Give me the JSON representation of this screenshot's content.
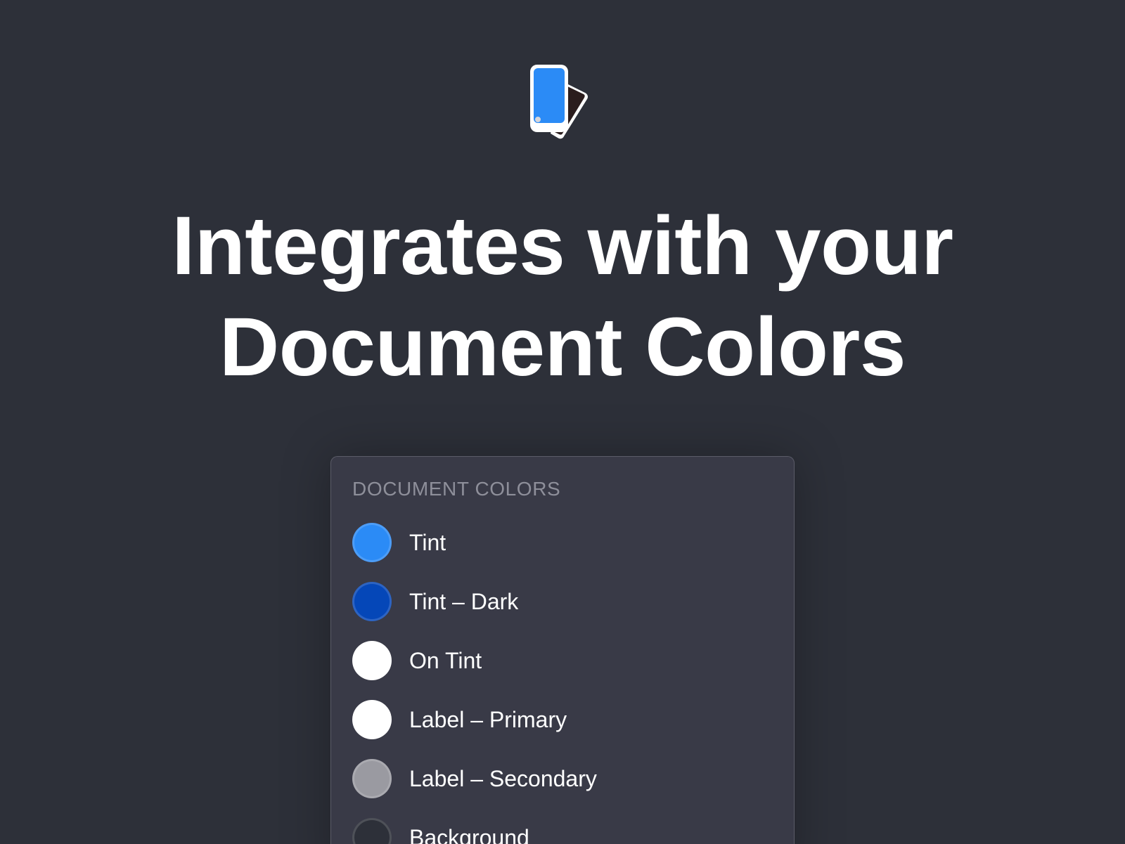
{
  "logo": {
    "icon": "color-swatch-cards-icon",
    "front_color": "#2b8bf6",
    "back_color": "#2b1d1d"
  },
  "headline": {
    "line1": "Integrates with your",
    "line2": "Document Colors"
  },
  "panel": {
    "title": "DOCUMENT COLORS",
    "items": [
      {
        "label": "Tint",
        "color": "#2b8bf6"
      },
      {
        "label": "Tint – Dark",
        "color": "#0547b8"
      },
      {
        "label": "On Tint",
        "color": "#ffffff"
      },
      {
        "label": "Label – Primary",
        "color": "#ffffff"
      },
      {
        "label": "Label – Secondary",
        "color": "#9a9aa1"
      },
      {
        "label": "Background",
        "color": "#2d3039"
      }
    ]
  }
}
